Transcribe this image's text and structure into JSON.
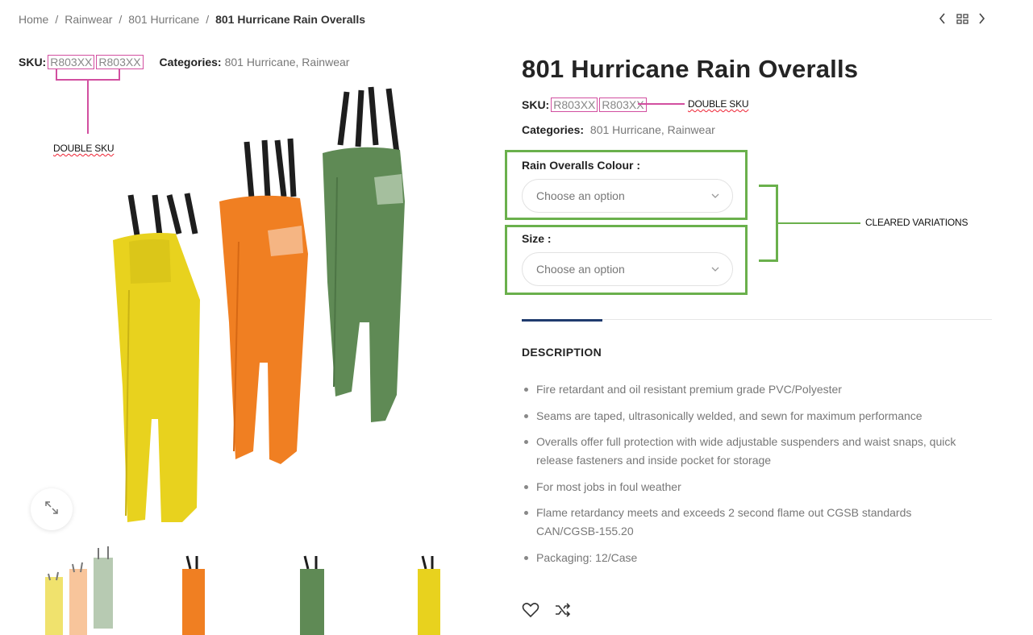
{
  "breadcrumb": {
    "home": "Home",
    "cat1": "Rainwear",
    "cat2": "801 Hurricane",
    "current": "801 Hurricane Rain Overalls",
    "sep": "/"
  },
  "left_meta": {
    "sku_label": "SKU:",
    "sku_1": "R803XX",
    "sku_2": "R803XX",
    "categories_label": "Categories:",
    "categories_value": "801 Hurricane, Rainwear"
  },
  "annotations": {
    "double_sku_left": "DOUBLE SKU",
    "double_sku_right": "DOUBLE SKU",
    "cleared_variations": "CLEARED VARIATIONS",
    "annotation_pink": "#d24fa0",
    "annotation_green": "#6ab04c"
  },
  "product": {
    "title": "801 Hurricane Rain Overalls",
    "sku_label": "SKU:",
    "sku_1": "R803XX",
    "sku_2": "R803XX",
    "categories_label": "Categories:",
    "categories_value": "801 Hurricane, Rainwear"
  },
  "variations": {
    "colour_label": "Rain Overalls Colour :",
    "colour_value": "Choose an option",
    "size_label": "Size :",
    "size_value": "Choose an option"
  },
  "tabs": {
    "description_title": "DESCRIPTION",
    "accent": "#1f3b6e"
  },
  "description": {
    "items": [
      "Fire retardant and oil resistant premium grade PVC/Polyester",
      "Seams are taped, ultrasonically welded, and sewn for maximum performance",
      "Overalls offer full protection with wide adjustable suspenders and waist snaps, quick release fasteners and inside pocket for storage",
      "For most jobs in foul weather",
      "Flame retardancy meets and exceeds 2 second flame out CGSB standards CAN/CGSB-155.20",
      "Packaging: 12/Case"
    ]
  },
  "product_colors": {
    "yellow": "#e8d21e",
    "orange": "#f07f22",
    "green": "#5f8a55"
  },
  "icons": {
    "prev": "chevron-left-icon",
    "grid": "grid-icon",
    "next": "chevron-right-icon",
    "zoom": "expand-icon",
    "wishlist": "heart-icon",
    "compare": "shuffle-icon"
  }
}
